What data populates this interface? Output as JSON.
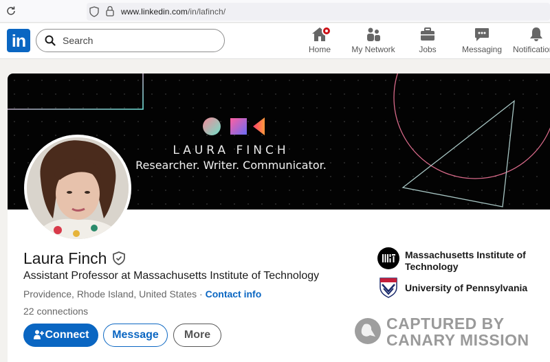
{
  "browser": {
    "url_host": "www.linkedin.com",
    "url_path": "/in/lafinch/"
  },
  "nav": {
    "logo_text": "in",
    "search_placeholder": "Search",
    "items": [
      {
        "label": "Home",
        "icon": "home-icon"
      },
      {
        "label": "My Network",
        "icon": "network-icon"
      },
      {
        "label": "Jobs",
        "icon": "briefcase-icon"
      },
      {
        "label": "Messaging",
        "icon": "messaging-icon"
      },
      {
        "label": "Notifications",
        "icon": "bell-icon"
      }
    ]
  },
  "banner": {
    "name": "LAURA FINCH",
    "tagline": "Researcher. Writer. Communicator."
  },
  "profile": {
    "name": "Laura Finch",
    "headline": "Assistant Professor at Massachusetts Institute of Technology",
    "location": "Providence, Rhode Island, United States",
    "location_sep": " · ",
    "contact_info": "Contact info",
    "connections": "22 connections"
  },
  "actions": {
    "connect": "Connect",
    "message": "Message",
    "more": "More"
  },
  "education": [
    {
      "name_line1": "Massachusetts Institute of",
      "name_line2": "Technology"
    },
    {
      "name": "University of Pennsylvania"
    }
  ],
  "watermark": {
    "line1": "CAPTURED BY",
    "line2": "CANARY MISSION"
  },
  "colors": {
    "linkedin_blue": "#0a66c2",
    "notification_red": "#cc1016"
  }
}
